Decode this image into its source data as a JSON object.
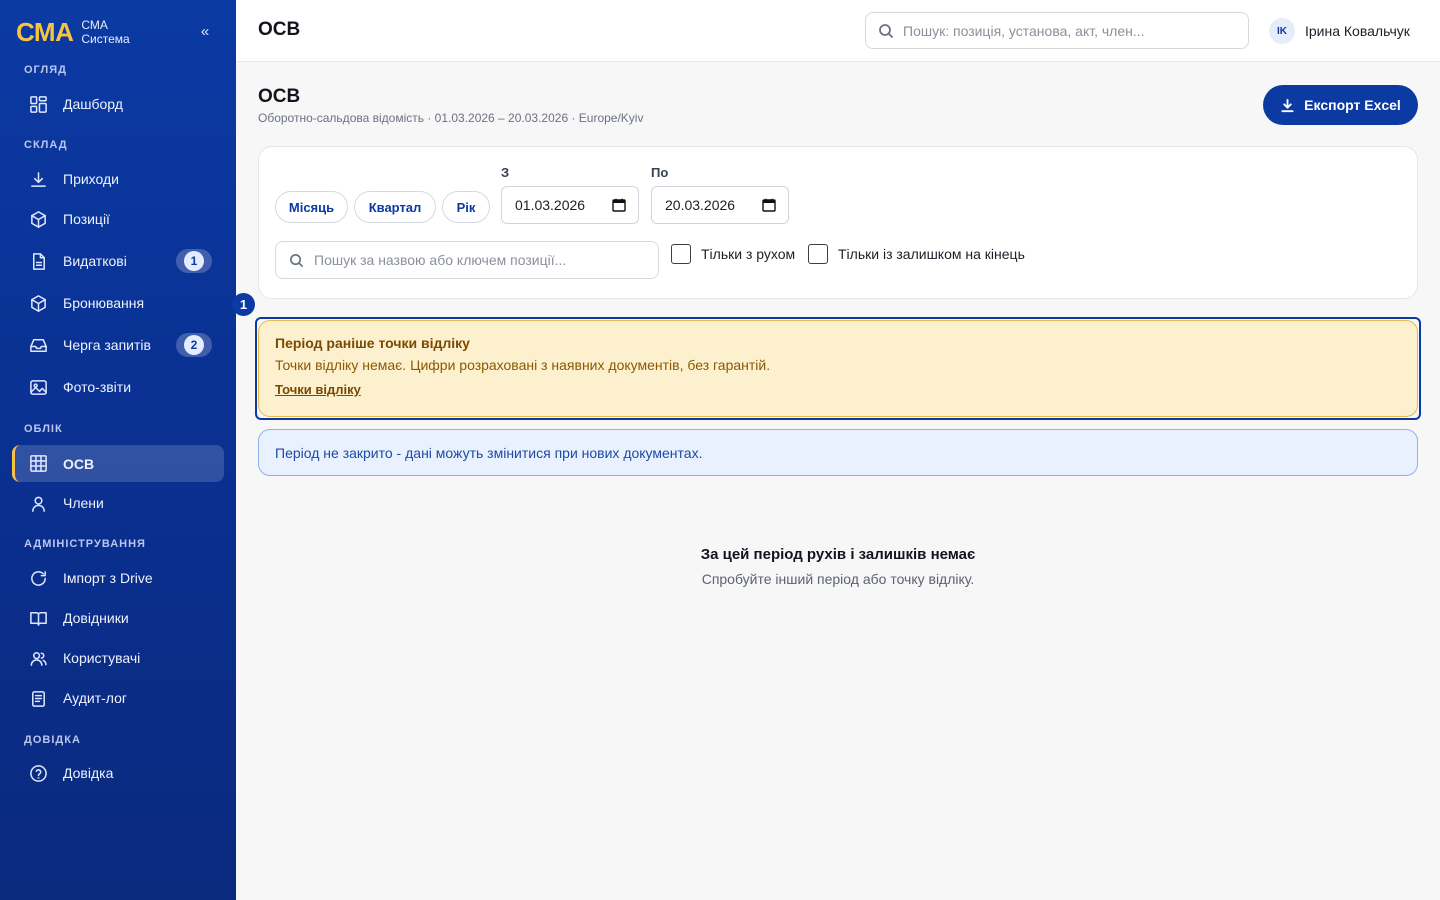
{
  "brand": {
    "logo": "СМА",
    "line1": "СМА",
    "line2": "Система",
    "collapse": "«"
  },
  "sidebar": {
    "sections": [
      {
        "label": "ОГЛЯД"
      },
      {
        "label": "СКЛАД"
      },
      {
        "label": "ОБЛІК"
      },
      {
        "label": "АДМІНІСТРУВАННЯ"
      },
      {
        "label": "ДОВІДКА"
      }
    ],
    "items": [
      {
        "label": "Дашборд",
        "icon": "dashboard-icon"
      },
      {
        "label": "Приходи",
        "icon": "download-icon"
      },
      {
        "label": "Позиції",
        "icon": "box-icon"
      },
      {
        "label": "Видаткові",
        "icon": "document-icon",
        "badge": "1"
      },
      {
        "label": "Бронювання",
        "icon": "box-icon"
      },
      {
        "label": "Черга запитів",
        "icon": "inbox-icon",
        "badge": "2"
      },
      {
        "label": "Фото-звіти",
        "icon": "image-icon"
      },
      {
        "label": "ОСВ",
        "icon": "grid-table-icon",
        "active": true
      },
      {
        "label": "Члени",
        "icon": "user-icon"
      },
      {
        "label": "Імпорт з Drive",
        "icon": "refresh-icon"
      },
      {
        "label": "Довідники",
        "icon": "book-icon"
      },
      {
        "label": "Користувачі",
        "icon": "users-icon"
      },
      {
        "label": "Аудит-лог",
        "icon": "clipboard-icon"
      },
      {
        "label": "Довідка",
        "icon": "help-circle-icon"
      }
    ]
  },
  "header": {
    "title": "ОСВ",
    "search_placeholder": "Пошук: позиція, установа, акт, член...",
    "user": {
      "initials": "IK",
      "name": "Ірина Ковальчук"
    }
  },
  "main": {
    "title": "ОСВ",
    "subtitle": "Оборотно-сальдова відомість · 01.03.2026 – 20.03.2026 · Europe/Kyiv",
    "export_label": "Експорт Excel",
    "filters": {
      "presets": [
        "Місяць",
        "Квартал",
        "Рік"
      ],
      "from_label": "З",
      "from_value": "01.03.2026",
      "to_label": "По",
      "to_value": "20.03.2026",
      "search_placeholder": "Пошук за назвою або ключем позиції...",
      "only_movement": "Тільки з рухом",
      "only_balance": "Тільки із залишком на кінець"
    },
    "step_number": "1",
    "warning": {
      "title": "Період раніше точки відліку",
      "text": "Точки відліку немає. Цифри розраховані з наявних документів, без гарантій.",
      "link": "Точки відліку"
    },
    "info": "Період не закрито - дані можуть змінитися при нових документах.",
    "empty": {
      "title": "За цей період рухів і залишків немає",
      "subtitle": "Спробуйте інший період або точку відліку."
    }
  },
  "colors": {
    "sidebar": "#0b3aa3",
    "accent": "#f6c343",
    "warning_bg": "#fdf0cf",
    "info_bg": "#e9f1ff"
  }
}
